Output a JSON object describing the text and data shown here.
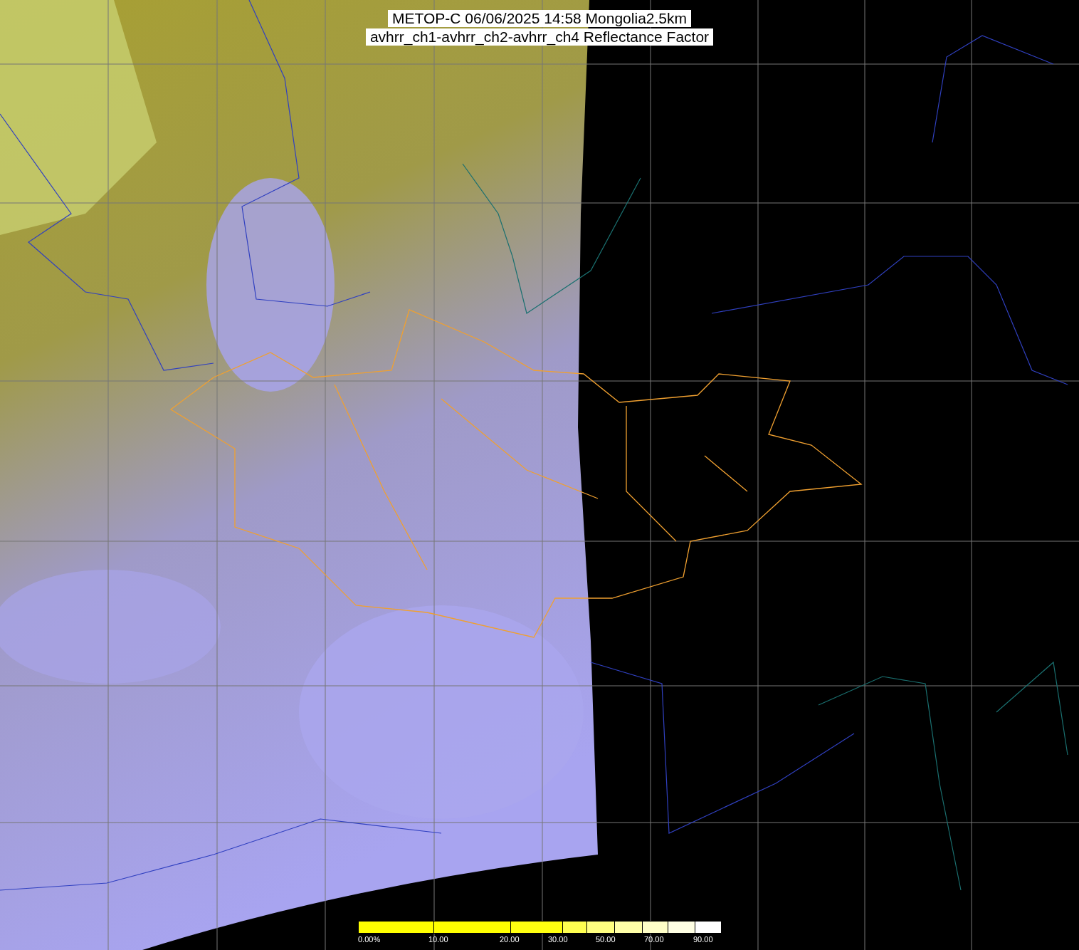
{
  "title": {
    "lines": [
      "METOP-C 06/06/2025 14:58 Mongolia2.5km",
      "avhrr_ch1-avhrr_ch2-avhrr_ch4 Reflectance Factor"
    ]
  },
  "colorbar": {
    "segments": [
      {
        "color": "#ffff00"
      },
      {
        "color": "#ffff00"
      },
      {
        "color": "#ffff10"
      },
      {
        "color": "#ffff50"
      },
      {
        "color": "#ffff80"
      },
      {
        "color": "#ffffa8"
      },
      {
        "color": "#ffffc8"
      },
      {
        "color": "#ffffe4"
      },
      {
        "color": "#ffffff"
      }
    ],
    "labels": [
      "0.00%",
      "10.00",
      "20.00",
      "30.00",
      "50.00",
      "70.00",
      "90.00"
    ]
  }
}
